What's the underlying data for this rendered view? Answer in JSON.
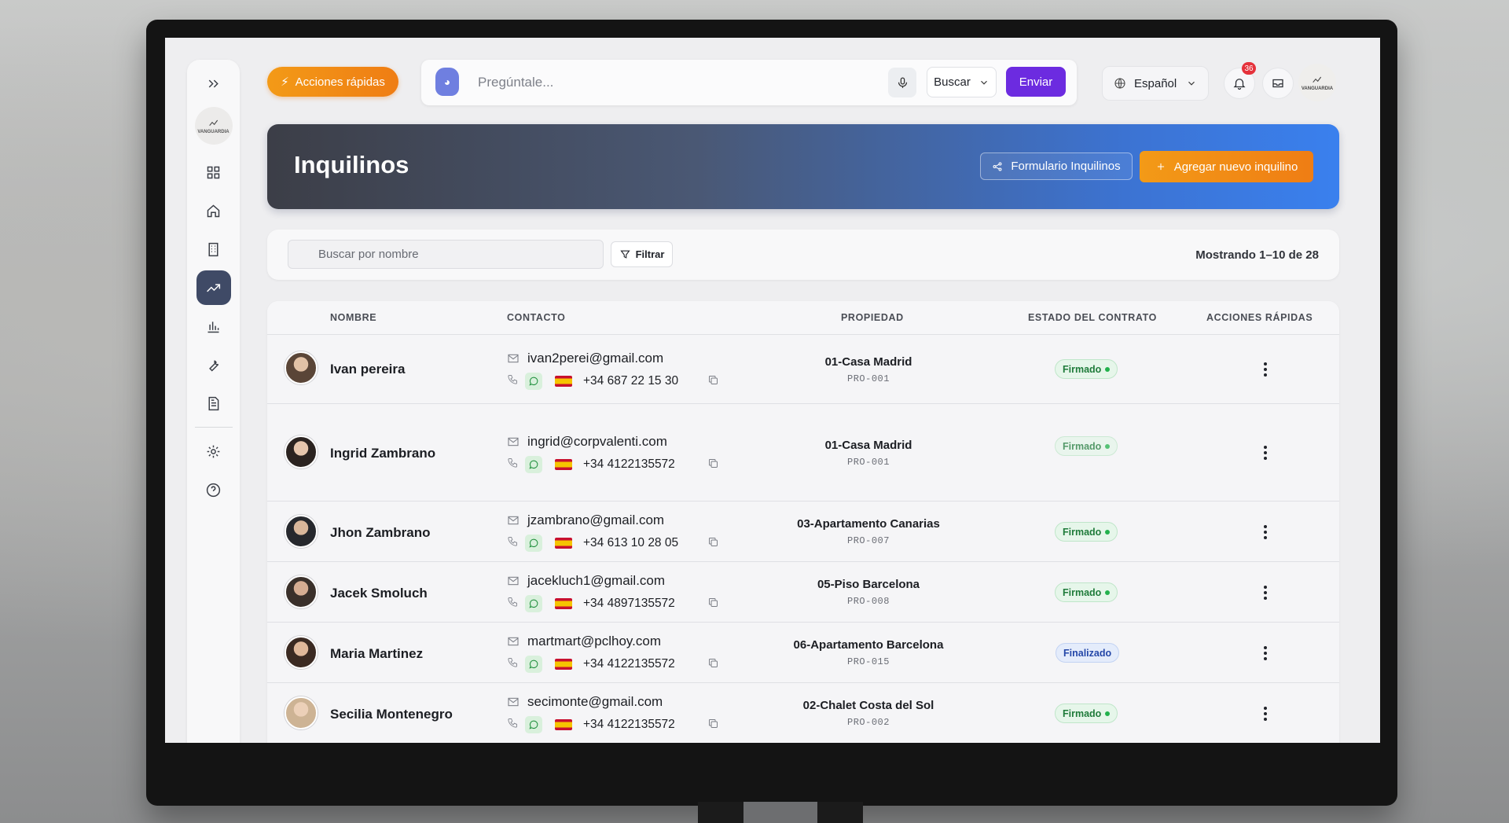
{
  "topbar": {
    "quick_actions_label": "Acciones rápidas",
    "ask_placeholder": "Pregúntale...",
    "search_mode_label": "Buscar",
    "send_label": "Enviar",
    "language_label": "Español",
    "notifications_count": "36",
    "brand_label": "VANGUARDIA"
  },
  "sidebar": {
    "brand_label": "VANGUARDIA",
    "items": [
      {
        "icon": "expand-icon"
      },
      {
        "icon": "grid-icon"
      },
      {
        "icon": "home-icon"
      },
      {
        "icon": "building-icon"
      },
      {
        "icon": "trending-icon",
        "active": true
      },
      {
        "icon": "bar-chart-icon"
      },
      {
        "icon": "wrench-icon"
      },
      {
        "icon": "document-icon"
      },
      {
        "icon": "gear-icon"
      },
      {
        "icon": "help-icon"
      }
    ]
  },
  "header": {
    "title": "Inquilinos",
    "form_button_label": "Formulario Inquilinos",
    "add_button_label": "Agregar nuevo inquilino"
  },
  "filters": {
    "search_placeholder": "Buscar por nombre",
    "filter_label": "Filtrar",
    "count_label": "Mostrando 1–10 de 28"
  },
  "table": {
    "columns": [
      "NOMBRE",
      "CONTACTO",
      "PROPIEDAD",
      "ESTADO DEL CONTRATO",
      "ACCIONES RÁPIDAS"
    ],
    "rows": [
      {
        "name": "Ivan pereira",
        "email": "ivan2perei@gmail.com",
        "phone": "+34 687 22 15 30",
        "property": "01-Casa Madrid",
        "code": "PRO-001",
        "status": "Firmado",
        "status_kind": "ok"
      },
      {
        "name": "Ingrid Zambrano",
        "email": "ingrid@corpvalenti.com",
        "phone": "+34 4122135572",
        "property": "01-Casa Madrid",
        "code": "PRO-001",
        "status": "Firmado",
        "status_kind": "ok"
      },
      {
        "name": "Jhon Zambrano",
        "email": "jzambrano@gmail.com",
        "phone": "+34 613 10 28 05",
        "property": "03-Apartamento Canarias",
        "code": "PRO-007",
        "status": "Firmado",
        "status_kind": "ok"
      },
      {
        "name": "Jacek Smoluch",
        "email": "jacekluch1@gmail.com",
        "phone": "+34 4897135572",
        "property": "05-Piso Barcelona",
        "code": "PRO-008",
        "status": "Firmado",
        "status_kind": "ok"
      },
      {
        "name": "Maria Martinez",
        "email": "martmart@pclhoy.com",
        "phone": "+34 4122135572",
        "property": "06-Apartamento Barcelona",
        "code": "PRO-015",
        "status": "Finalizado",
        "status_kind": "fin"
      },
      {
        "name": "Secilia Montenegro",
        "email": "secimonte@gmail.com",
        "phone": "+34 4122135572",
        "property": "02-Chalet Costa del Sol",
        "code": "PRO-002",
        "status": "Firmado",
        "status_kind": "ok"
      }
    ]
  },
  "colors": {
    "accent_orange": "#ef7d14",
    "send_purple": "#6c2be0",
    "hero_blue": "#3a80ee",
    "status_green": "#22b14c",
    "status_blue": "#2447a8"
  }
}
